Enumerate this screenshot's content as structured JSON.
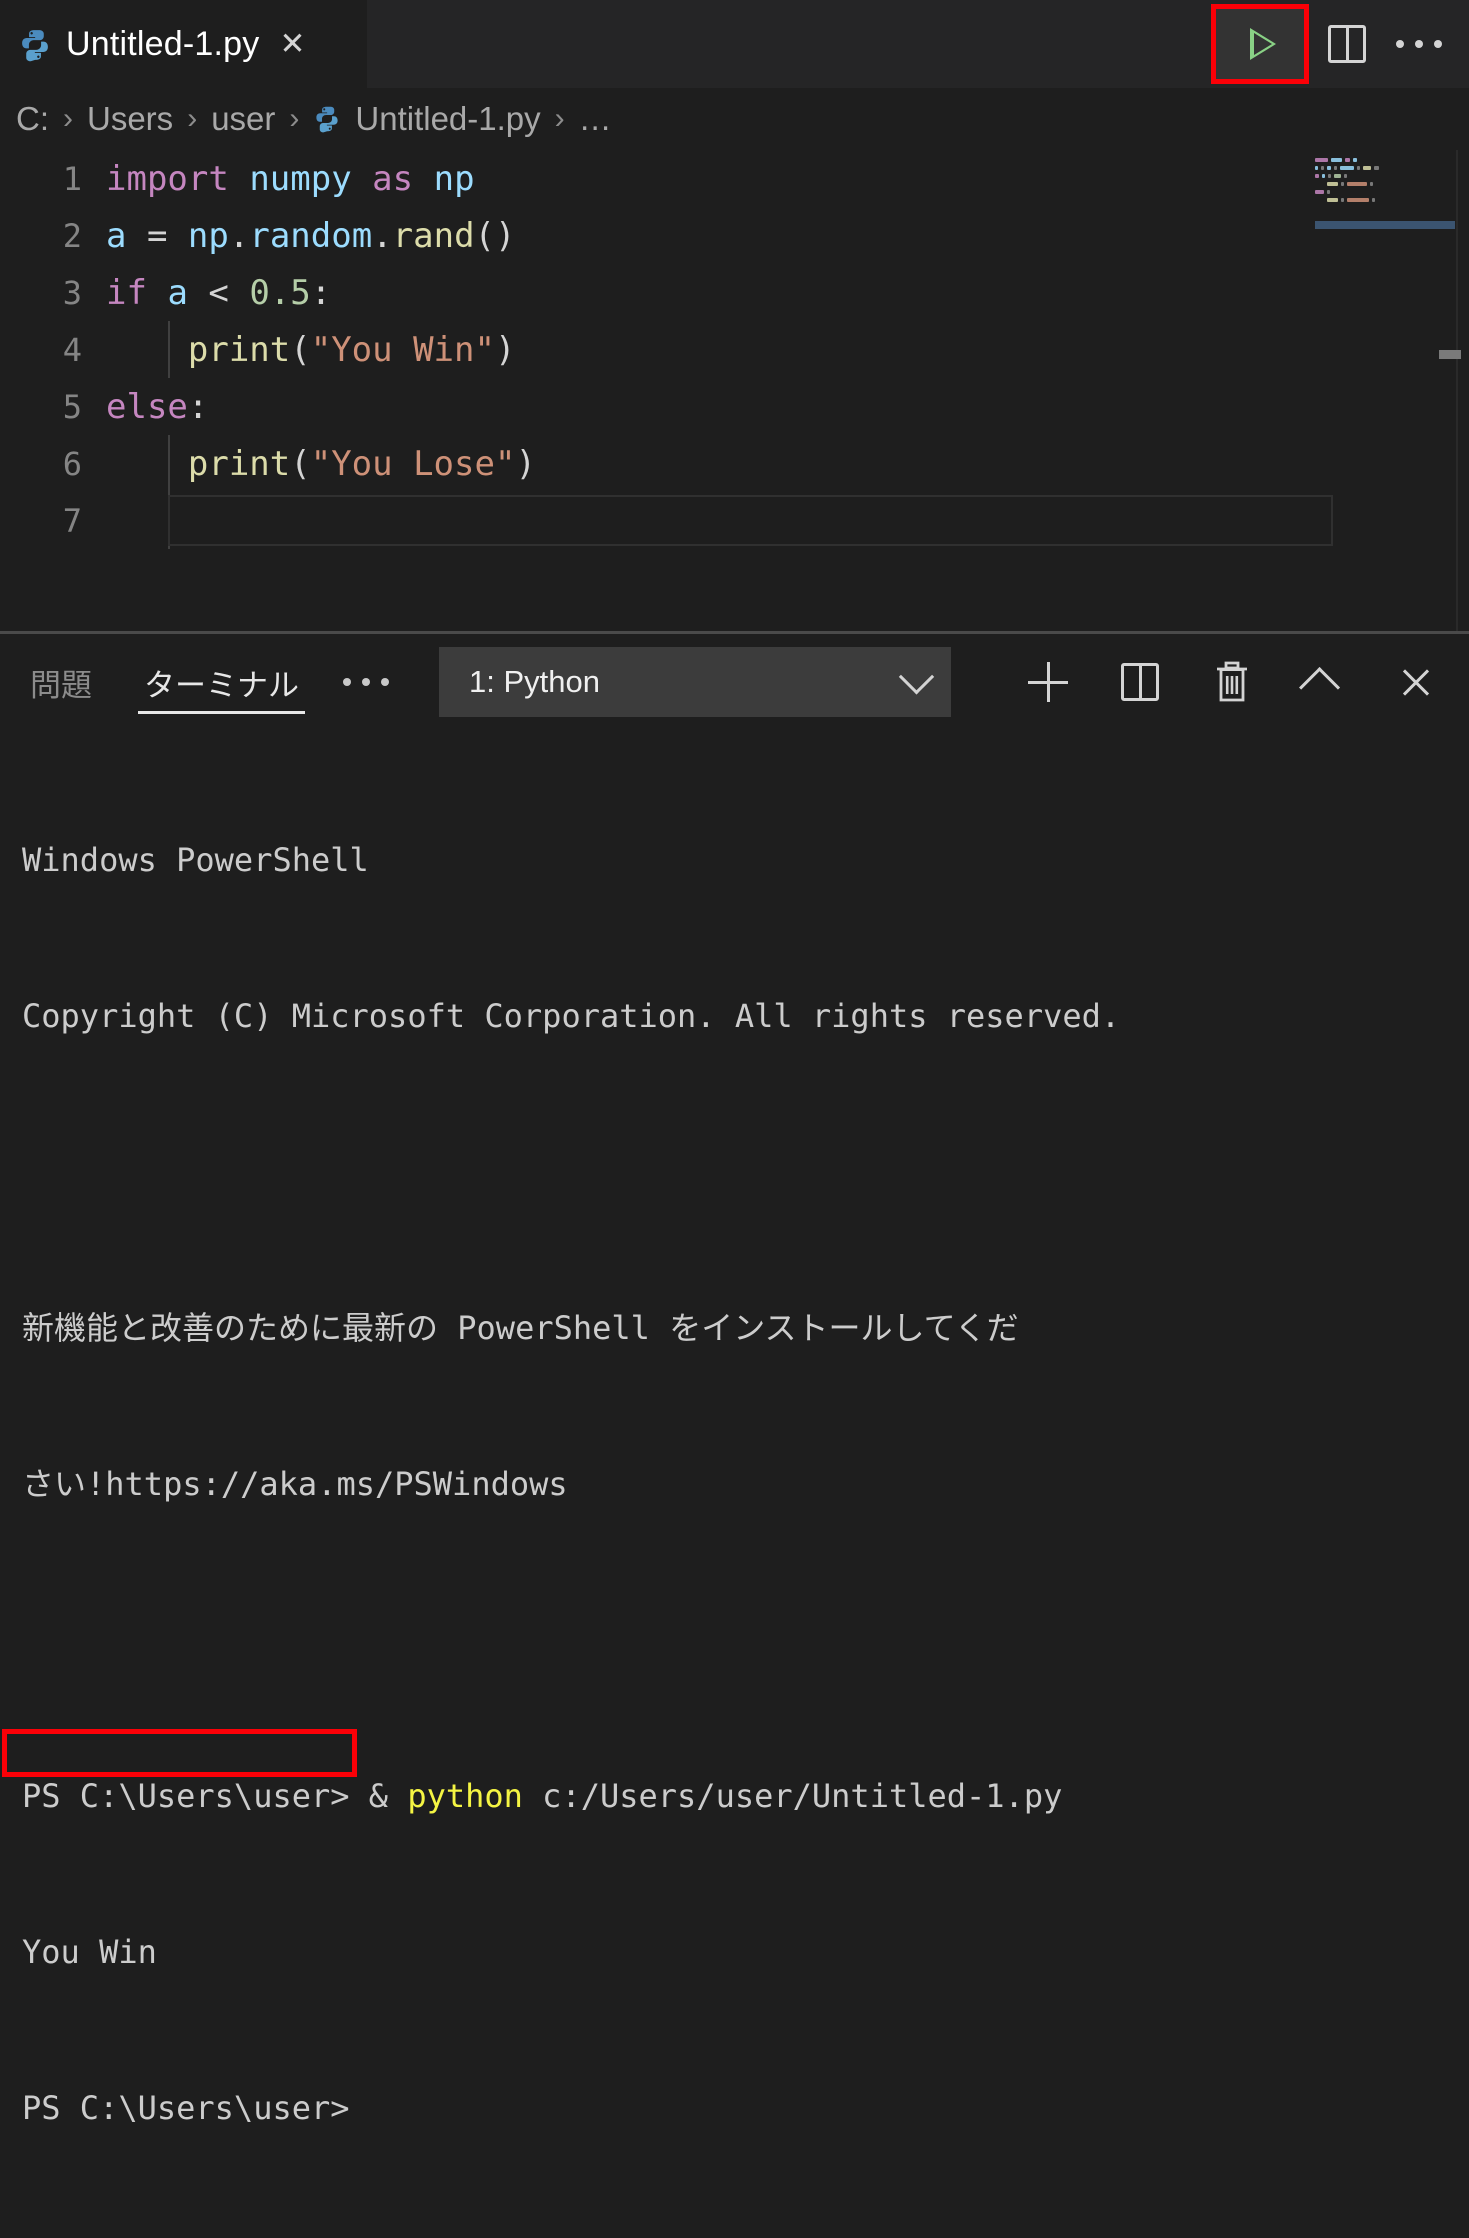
{
  "window": {
    "background_color": "#1e1e1e",
    "accent_highlight_color": "#fb0007"
  },
  "tabbar": {
    "tab": {
      "icon": "python-file-icon",
      "label": "Untitled-1.py",
      "close_label": "✕"
    },
    "actions": [
      {
        "name": "run-python-file-button",
        "icon": "play-triangle-icon",
        "highlighted": true
      },
      {
        "name": "split-editor-right-button",
        "icon": "split-editor-icon"
      },
      {
        "name": "more-actions-button",
        "icon": "ellipsis-icon"
      }
    ]
  },
  "breadcrumb": {
    "separator": "›",
    "items": [
      {
        "label": "C:"
      },
      {
        "label": "Users"
      },
      {
        "label": "user"
      },
      {
        "label": "Untitled-1.py",
        "icon": "python-file-icon"
      },
      {
        "label": "…"
      }
    ]
  },
  "editor": {
    "language": "python",
    "current_line": 7,
    "lines": [
      {
        "n": "1",
        "tokens": [
          {
            "t": "import",
            "c": "k"
          },
          {
            "t": " ",
            "c": "op"
          },
          {
            "t": "numpy",
            "c": "v"
          },
          {
            "t": " ",
            "c": "op"
          },
          {
            "t": "as",
            "c": "k"
          },
          {
            "t": " ",
            "c": "op"
          },
          {
            "t": "np",
            "c": "v"
          }
        ]
      },
      {
        "n": "2",
        "tokens": [
          {
            "t": "a ",
            "c": "v"
          },
          {
            "t": "= ",
            "c": "op"
          },
          {
            "t": "np",
            "c": "v"
          },
          {
            "t": ".",
            "c": "op"
          },
          {
            "t": "random",
            "c": "v"
          },
          {
            "t": ".",
            "c": "op"
          },
          {
            "t": "rand",
            "c": "fn"
          },
          {
            "t": "()",
            "c": "op"
          }
        ]
      },
      {
        "n": "3",
        "tokens": [
          {
            "t": "if",
            "c": "k"
          },
          {
            "t": " ",
            "c": "op"
          },
          {
            "t": "a ",
            "c": "v"
          },
          {
            "t": "< ",
            "c": "op"
          },
          {
            "t": "0.5",
            "c": "nu"
          },
          {
            "t": ":",
            "c": "op"
          }
        ]
      },
      {
        "n": "4",
        "indent": true,
        "tokens": [
          {
            "t": "    ",
            "c": "op"
          },
          {
            "t": "print",
            "c": "fn"
          },
          {
            "t": "(",
            "c": "op"
          },
          {
            "t": "\"You Win\"",
            "c": "st"
          },
          {
            "t": ")",
            "c": "op"
          }
        ]
      },
      {
        "n": "5",
        "tokens": [
          {
            "t": "else",
            "c": "k"
          },
          {
            "t": ":",
            "c": "op"
          }
        ]
      },
      {
        "n": "6",
        "indent": true,
        "tokens": [
          {
            "t": "    ",
            "c": "op"
          },
          {
            "t": "print",
            "c": "fn"
          },
          {
            "t": "(",
            "c": "op"
          },
          {
            "t": "\"You Lose\"",
            "c": "st"
          },
          {
            "t": ")",
            "c": "op"
          }
        ]
      },
      {
        "n": "7",
        "indent": true,
        "cursor": true,
        "tokens": [
          {
            "t": "",
            "c": "op"
          }
        ]
      }
    ]
  },
  "panel": {
    "tabs": [
      {
        "label": "問題",
        "active": false,
        "name": "tab-problems"
      },
      {
        "label": "ターミナル",
        "active": true,
        "name": "tab-terminal"
      }
    ],
    "more_tabs_icon": "ellipsis-icon",
    "terminal_selector": {
      "value": "1: Python",
      "chevron": "chevron-down-icon"
    },
    "actions": [
      {
        "name": "new-terminal-button",
        "icon": "plus-icon"
      },
      {
        "name": "split-terminal-button",
        "icon": "split-icon"
      },
      {
        "name": "kill-terminal-button",
        "icon": "trash-icon"
      },
      {
        "name": "maximize-panel-button",
        "icon": "chevron-up-icon"
      },
      {
        "name": "close-panel-button",
        "icon": "close-icon"
      }
    ]
  },
  "terminal": {
    "lines": [
      {
        "id": "l1",
        "text": "Windows PowerShell"
      },
      {
        "id": "l2",
        "text": "Copyright (C) Microsoft Corporation. All rights reserved."
      },
      {
        "id": "l3",
        "text": ""
      },
      {
        "id": "l4",
        "text": "新機能と改善のために最新の PowerShell をインストールしてくだ"
      },
      {
        "id": "l5",
        "text": "さい!https://aka.ms/PSWindows"
      },
      {
        "id": "l6",
        "text": ""
      },
      {
        "id": "l7",
        "prompt": "PS C:\\Users\\user> & ",
        "command": "python",
        "args": " c:/Users/user/Untitled-1.py"
      },
      {
        "id": "l8",
        "text": "You Win",
        "highlighted": true
      },
      {
        "id": "l9",
        "text": "PS C:\\Users\\user>"
      }
    ]
  }
}
